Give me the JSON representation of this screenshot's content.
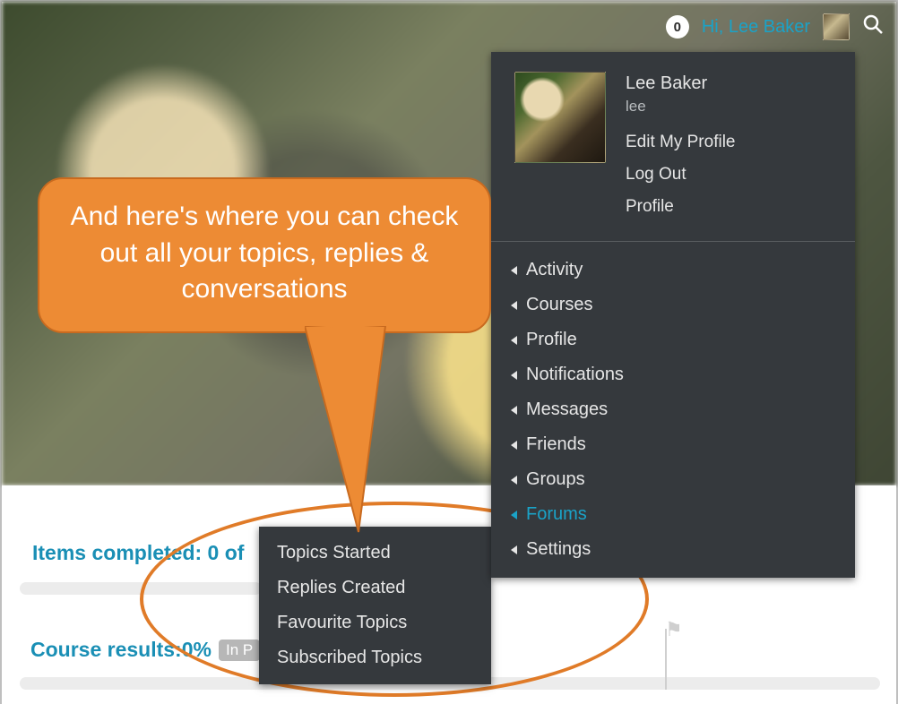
{
  "topbar": {
    "badge_count": "0",
    "greeting": "Hi, Lee Baker"
  },
  "dropdown": {
    "name": "Lee Baker",
    "username": "lee",
    "links": {
      "edit_profile": "Edit My Profile",
      "logout": "Log Out",
      "profile": "Profile"
    },
    "menu": {
      "activity": "Activity",
      "courses": "Courses",
      "profile": "Profile",
      "notifications": "Notifications",
      "messages": "Messages",
      "friends": "Friends",
      "groups": "Groups",
      "forums": "Forums",
      "settings": "Settings"
    }
  },
  "submenu": {
    "topics_started": "Topics Started",
    "replies_created": "Replies Created",
    "favourite_topics": "Favourite Topics",
    "subscribed_topics": "Subscribed Topics"
  },
  "content": {
    "items_completed": "Items completed: 0 of",
    "course_results_label": "Course results:",
    "course_results_value": "0%",
    "pill": "In P"
  },
  "callout": {
    "text": "And here's where you can check out all your topics, replies & conversations"
  }
}
